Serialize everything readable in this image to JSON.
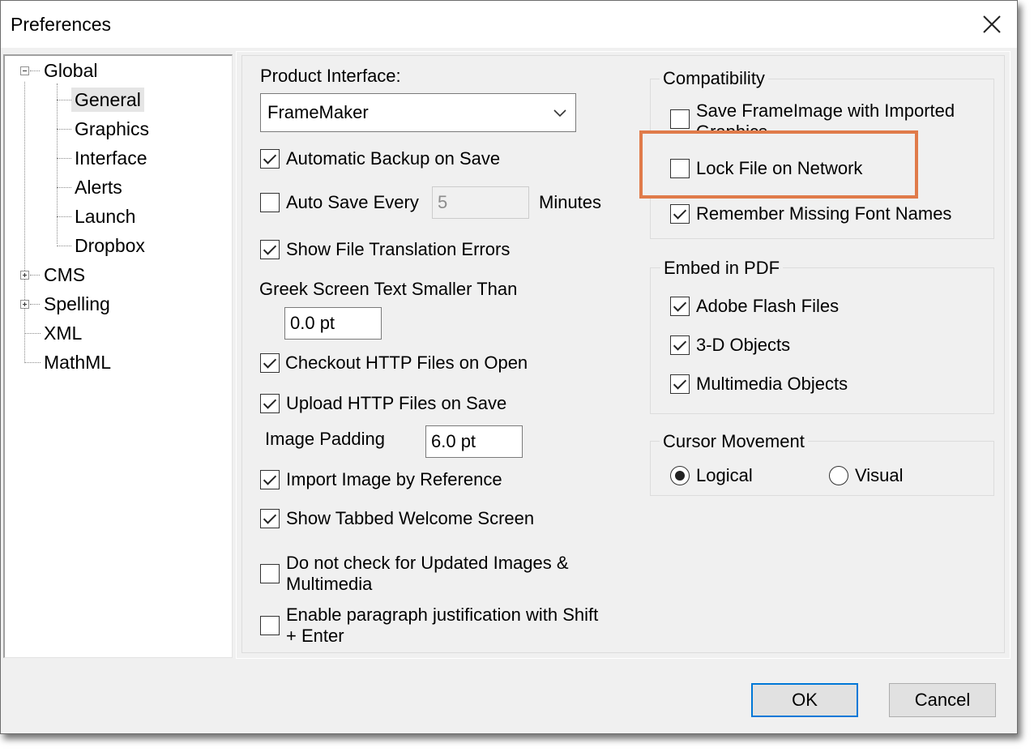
{
  "window": {
    "title": "Preferences"
  },
  "tree": [
    {
      "label": "Global",
      "expander": "minus"
    },
    {
      "label": "General",
      "selected": true
    },
    {
      "label": "Graphics"
    },
    {
      "label": "Interface"
    },
    {
      "label": "Alerts"
    },
    {
      "label": "Launch"
    },
    {
      "label": "Dropbox"
    },
    {
      "label": "CMS",
      "expander": "plus"
    },
    {
      "label": "Spelling",
      "expander": "plus"
    },
    {
      "label": "XML"
    },
    {
      "label": "MathML"
    }
  ],
  "general": {
    "product_interface_label": "Product Interface:",
    "product_interface_value": "FrameMaker",
    "automatic_backup": {
      "label": "Automatic Backup on Save",
      "checked": true
    },
    "auto_save": {
      "label": "Auto Save Every",
      "checked": false,
      "value": "5",
      "unit": "Minutes"
    },
    "show_translation_errors": {
      "label": "Show File Translation Errors",
      "checked": true
    },
    "greek_label": "Greek Screen Text Smaller Than",
    "greek_value": "0.0 pt",
    "checkout_http": {
      "label": "Checkout HTTP Files on Open",
      "checked": true
    },
    "upload_http": {
      "label": "Upload HTTP Files on Save",
      "checked": true
    },
    "image_padding_label": "Image Padding",
    "image_padding_value": "6.0 pt",
    "import_by_reference": {
      "label": "Import Image by Reference",
      "checked": true
    },
    "tabbed_welcome": {
      "label": "Show Tabbed Welcome Screen",
      "checked": true
    },
    "no_check_updated": {
      "label": "Do not check for Updated Images & Multimedia",
      "checked": false
    },
    "enable_justification": {
      "label": "Enable paragraph justification with Shift + Enter",
      "checked": false
    }
  },
  "compatibility": {
    "title": "Compatibility",
    "save_frameimage": {
      "label": "Save FrameImage with Imported Graphics",
      "checked": false
    },
    "lock_file": {
      "label": "Lock File on Network",
      "checked": false
    },
    "remember_fonts": {
      "label": "Remember Missing Font Names",
      "checked": true
    }
  },
  "embed_pdf": {
    "title": "Embed in PDF",
    "flash": {
      "label": "Adobe Flash Files",
      "checked": true
    },
    "objects_3d": {
      "label": "3-D Objects",
      "checked": true
    },
    "multimedia": {
      "label": "Multimedia Objects",
      "checked": true
    }
  },
  "cursor_movement": {
    "title": "Cursor Movement",
    "logical": {
      "label": "Logical",
      "selected": true
    },
    "visual": {
      "label": "Visual",
      "selected": false
    }
  },
  "buttons": {
    "ok": "OK",
    "cancel": "Cancel"
  },
  "colors": {
    "highlight": "#e07b4a",
    "default_button_border": "#0078d7"
  },
  "icons": {
    "close": "close-icon",
    "dropdown": "chevron-down-icon"
  }
}
